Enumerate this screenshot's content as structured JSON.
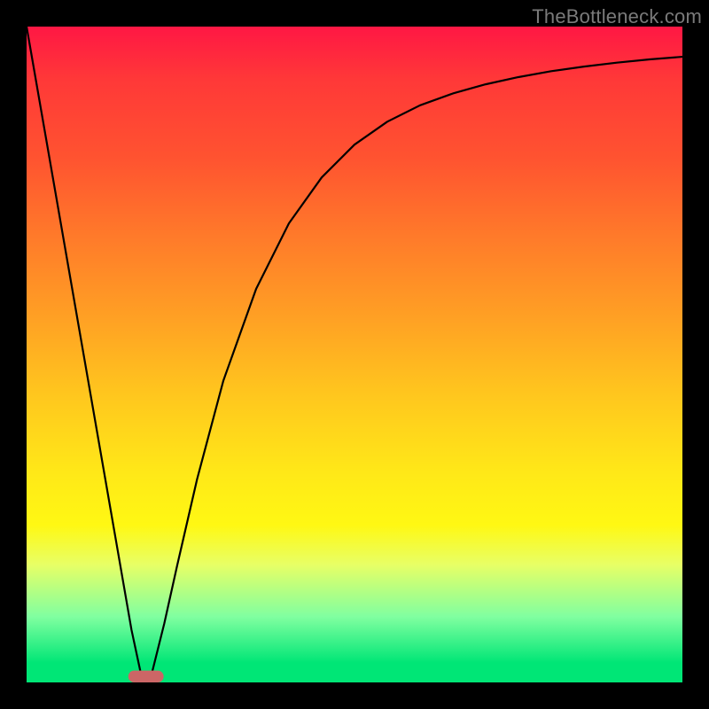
{
  "watermark": "TheBottleneck.com",
  "chart_data": {
    "type": "line",
    "title": "",
    "xlabel": "",
    "ylabel": "",
    "xlim": [
      0,
      100
    ],
    "ylim": [
      0,
      100
    ],
    "series": [
      {
        "name": "curve",
        "x": [
          0,
          4,
          8,
          12,
          16,
          17.5,
          19,
          21,
          23,
          26,
          30,
          35,
          40,
          45,
          50,
          55,
          60,
          65,
          70,
          75,
          80,
          85,
          90,
          95,
          100
        ],
        "values": [
          100,
          77,
          54,
          31,
          8,
          1,
          1,
          9,
          18,
          31,
          46,
          60,
          70,
          77,
          82,
          85.5,
          88,
          89.8,
          91.2,
          92.3,
          93.2,
          93.9,
          94.5,
          95,
          95.4
        ]
      }
    ],
    "marker": {
      "name": "target-band",
      "x_center": 18.2,
      "x_halfwidth": 2.7,
      "y": 0.9,
      "height": 1.8,
      "color": "#cc6666"
    },
    "background_gradient": {
      "top": "#ff1744",
      "mid": "#ffe818",
      "bottom": "#00e676"
    },
    "frame_color": "#000000"
  }
}
